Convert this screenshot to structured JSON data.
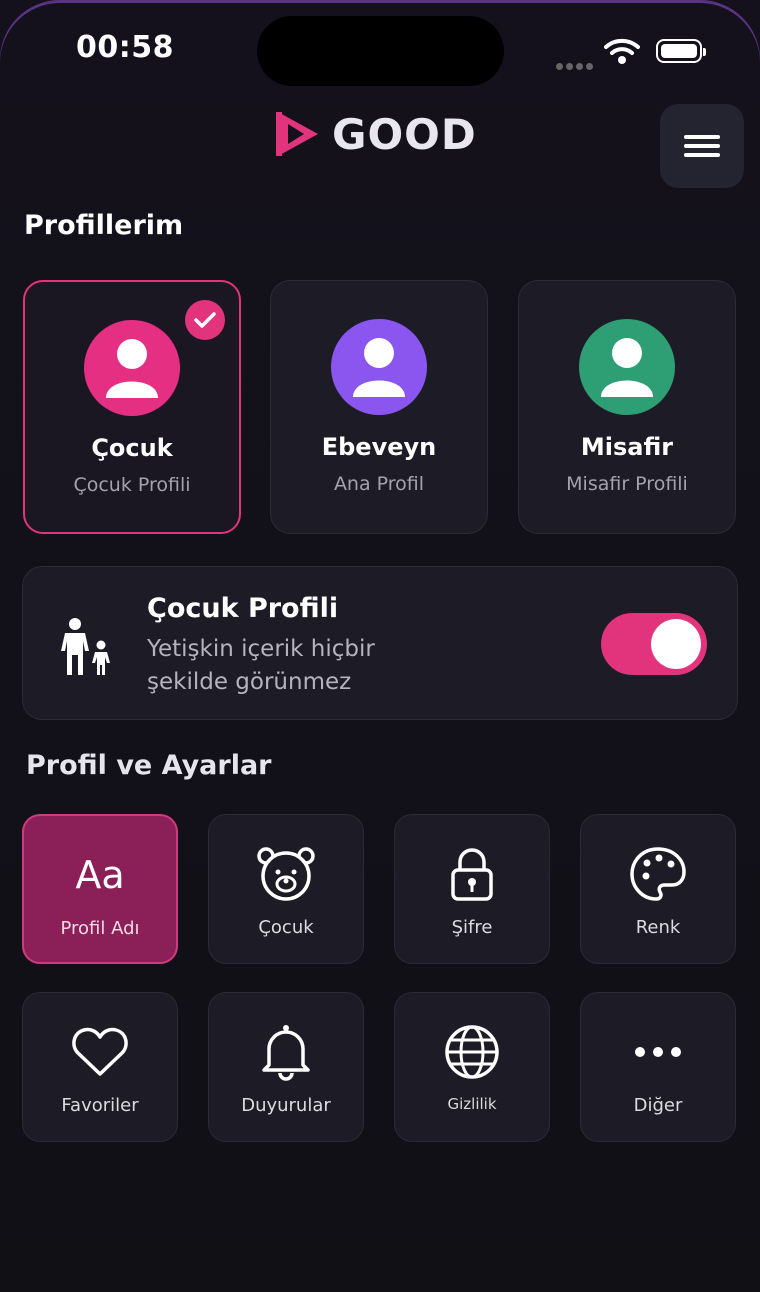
{
  "status_bar": {
    "time": "00:58"
  },
  "header": {
    "logo_text": "GOOD",
    "menu_icon": "hamburger-icon"
  },
  "profiles_section": {
    "title": "Profillerim",
    "profiles": [
      {
        "name": "Çocuk",
        "subtitle": "Çocuk Profili",
        "color": "#e42f83",
        "selected": true
      },
      {
        "name": "Ebeveyn",
        "subtitle": "Ana Profil",
        "color": "#8b55f0",
        "selected": false
      },
      {
        "name": "Misafir",
        "subtitle": "Misafir Profili",
        "color": "#2e9e74",
        "selected": false
      }
    ]
  },
  "child_mode": {
    "title": "Çocuk Profili",
    "description": "Yetişkin içerik hiçbir şekilde görünmez",
    "enabled": true,
    "icon": "family-icon"
  },
  "settings_section": {
    "title": "Profil ve Ayarlar",
    "tiles": [
      {
        "label": "Profil Adı",
        "icon": "text-aa-icon",
        "glyph": "Aa",
        "active": true
      },
      {
        "label": "Çocuk",
        "icon": "bear-icon",
        "active": false
      },
      {
        "label": "Şifre",
        "icon": "lock-icon",
        "active": false
      },
      {
        "label": "Renk",
        "icon": "palette-icon",
        "active": false
      },
      {
        "label": "Favoriler",
        "icon": "heart-icon",
        "active": false
      },
      {
        "label": "Duyurular",
        "icon": "bell-icon",
        "active": false
      },
      {
        "label": "Gizlilik",
        "icon": "globe-icon",
        "active": false
      },
      {
        "label": "Diğer",
        "icon": "more-icon",
        "active": false
      }
    ]
  },
  "colors": {
    "accent": "#e2337d",
    "background": "#120f18",
    "card": "#1d1c26"
  }
}
